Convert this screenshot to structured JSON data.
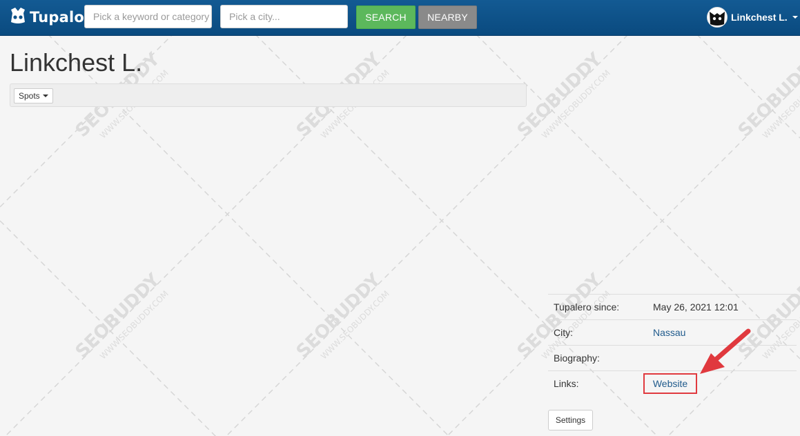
{
  "header": {
    "brand": "Tupalo",
    "keyword_placeholder": "Pick a keyword or category",
    "city_placeholder": "Pick a city...",
    "search_label": "SEARCH",
    "nearby_label": "NEARBY",
    "user_name": "Linkchest L."
  },
  "profile": {
    "name": "Linkchest L.",
    "spots_label": "Spots",
    "info": {
      "since_label": "Tupalero since:",
      "since_value": "May 26, 2021 12:01",
      "city_label": "City:",
      "city_value": "Nassau",
      "bio_label": "Biography:",
      "bio_value": "",
      "links_label": "Links:",
      "website_label": "Website"
    },
    "settings_label": "Settings"
  },
  "watermark": {
    "brand": "SEOBUDDY",
    "url": "WWW.SEOBUDDY.COM"
  },
  "colors": {
    "navbar": "#0f5289",
    "search_button": "#5cb85c",
    "nearby_button": "#8a8a8a",
    "link": "#1f5a8c",
    "highlight": "#e0393e"
  }
}
